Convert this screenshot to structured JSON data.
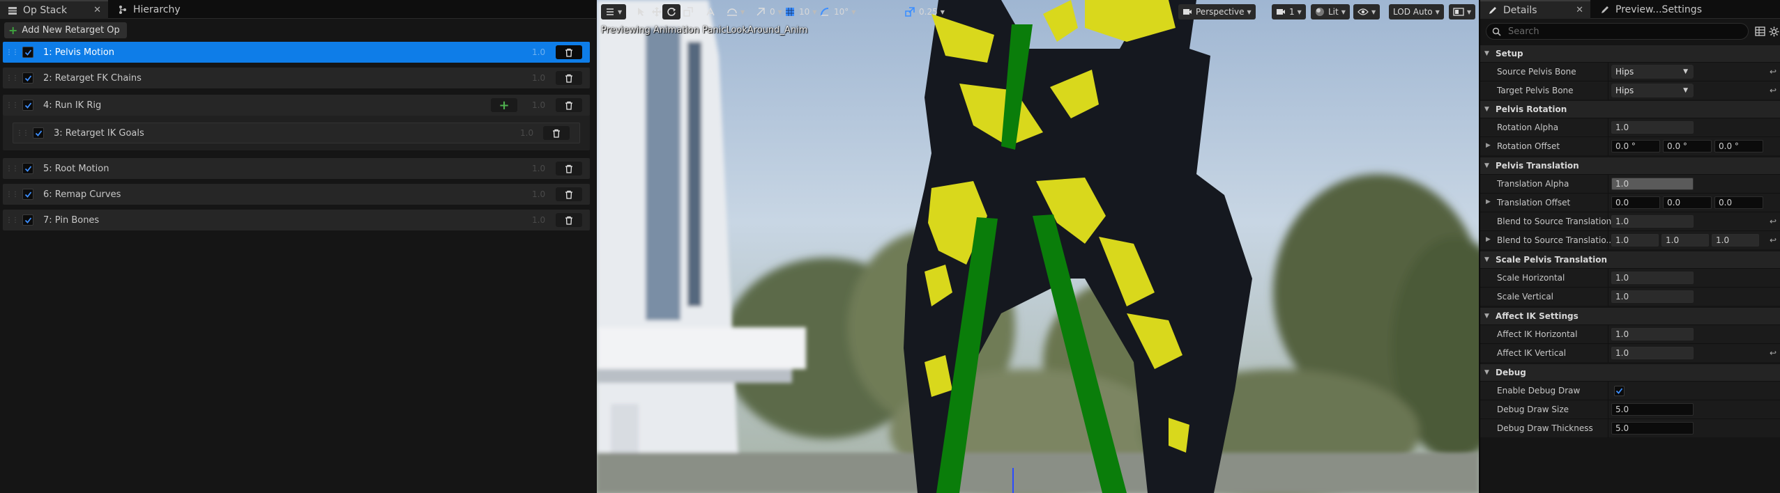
{
  "left_panel": {
    "tabs": [
      {
        "label": "Op Stack",
        "icon": "stack-icon",
        "close": "✕"
      },
      {
        "label": "Hierarchy",
        "icon": "hierarchy-icon"
      }
    ],
    "add_op_label": "Add New Retarget Op",
    "ops": [
      {
        "label": "1:  Pelvis Motion",
        "alpha": "1.0",
        "selected": true
      },
      {
        "label": "2:  Retarget FK Chains",
        "alpha": "1.0"
      },
      {
        "label": "4:  Run IK Rig",
        "alpha": "1.0",
        "has_add": true
      },
      {
        "label": "3:  Retarget IK Goals",
        "alpha": "1.0",
        "child": true
      },
      {
        "label": "5:  Root Motion",
        "alpha": "1.0"
      },
      {
        "label": "6:  Remap Curves",
        "alpha": "1.0"
      },
      {
        "label": "7:  Pin Bones",
        "alpha": "1.0"
      }
    ]
  },
  "viewport": {
    "toolbar": {
      "translate_snap": "0",
      "grid_snap": "10",
      "rotate_snap": "10°",
      "scale_snap": "0.25",
      "view_mode": "Perspective",
      "camera_speed": "1",
      "lighting": "Lit",
      "lod": "LOD Auto"
    },
    "overlay_text": "Previewing Animation PanicLookAround_Anim",
    "colors": {
      "sky": "#b6c8dc",
      "body": "#15181f",
      "armor": "#d9d81c",
      "bone": "#0a7d0a"
    }
  },
  "details": {
    "tabs": [
      {
        "label": "Details",
        "close": "✕"
      },
      {
        "label": "Preview...Settings"
      }
    ],
    "search_placeholder": "Search",
    "sections": [
      {
        "title": "Setup",
        "rows": [
          {
            "label": "Source Pelvis Bone",
            "type": "combo",
            "value": "Hips",
            "reset": true
          },
          {
            "label": "Target Pelvis Bone",
            "type": "combo",
            "value": "Hips",
            "reset": true
          }
        ]
      },
      {
        "title": "Pelvis Rotation",
        "rows": [
          {
            "label": "Rotation Alpha",
            "type": "slider",
            "value": "1.0"
          },
          {
            "label": "Rotation Offset",
            "type": "vec3",
            "values": [
              "0.0 °",
              "0.0 °",
              "0.0 °"
            ],
            "expandable": true
          }
        ]
      },
      {
        "title": "Pelvis Translation",
        "rows": [
          {
            "label": "Translation Alpha",
            "type": "slider",
            "value": "1.0",
            "highlight": true
          },
          {
            "label": "Translation Offset",
            "type": "vec3",
            "values": [
              "0.0",
              "0.0",
              "0.0"
            ],
            "expandable": true
          },
          {
            "label": "Blend to Source Translation",
            "type": "slider",
            "value": "1.0",
            "reset": true
          },
          {
            "label": "Blend to Source Translatio...",
            "type": "vec3s",
            "values": [
              "1.0",
              "1.0",
              "1.0"
            ],
            "expandable": true,
            "reset": true
          }
        ]
      },
      {
        "title": "Scale Pelvis Translation",
        "rows": [
          {
            "label": "Scale Horizontal",
            "type": "slider",
            "value": "1.0"
          },
          {
            "label": "Scale Vertical",
            "type": "slider",
            "value": "1.0"
          }
        ]
      },
      {
        "title": "Affect IK Settings",
        "rows": [
          {
            "label": "Affect IK Horizontal",
            "type": "slider",
            "value": "1.0"
          },
          {
            "label": "Affect IK Vertical",
            "type": "slider",
            "value": "1.0",
            "reset": true
          }
        ]
      },
      {
        "title": "Debug",
        "rows": [
          {
            "label": "Enable Debug Draw",
            "type": "checkbox",
            "value": true
          },
          {
            "label": "Debug Draw Size",
            "type": "number",
            "value": "5.0"
          },
          {
            "label": "Debug Draw Thickness",
            "type": "number",
            "value": "5.0"
          }
        ]
      }
    ]
  }
}
